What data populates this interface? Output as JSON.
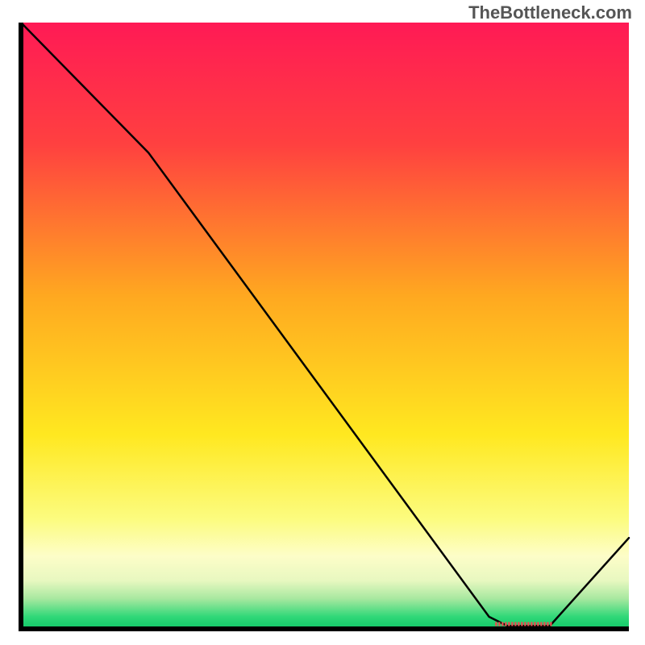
{
  "watermark": "TheBottleneck.com",
  "chart_data": {
    "type": "line",
    "title": "",
    "xlabel": "",
    "ylabel": "",
    "xlim": [
      0,
      100
    ],
    "ylim": [
      0,
      100
    ],
    "x": [
      0,
      21,
      77,
      80,
      87,
      100
    ],
    "values": [
      100,
      78.5,
      2,
      0.5,
      0.5,
      15
    ],
    "valley_marker": {
      "x_start": 78,
      "x_end": 87.5,
      "y": 0.8
    },
    "gradient_stops": [
      {
        "offset": 0,
        "color": "#ff1a55"
      },
      {
        "offset": 20,
        "color": "#ff4040"
      },
      {
        "offset": 45,
        "color": "#ffa820"
      },
      {
        "offset": 68,
        "color": "#ffe820"
      },
      {
        "offset": 82,
        "color": "#fcfc80"
      },
      {
        "offset": 88,
        "color": "#fdfdc8"
      },
      {
        "offset": 92,
        "color": "#e8f8c0"
      },
      {
        "offset": 95,
        "color": "#a8e8a0"
      },
      {
        "offset": 98,
        "color": "#30d878"
      },
      {
        "offset": 100,
        "color": "#10c868"
      }
    ]
  }
}
